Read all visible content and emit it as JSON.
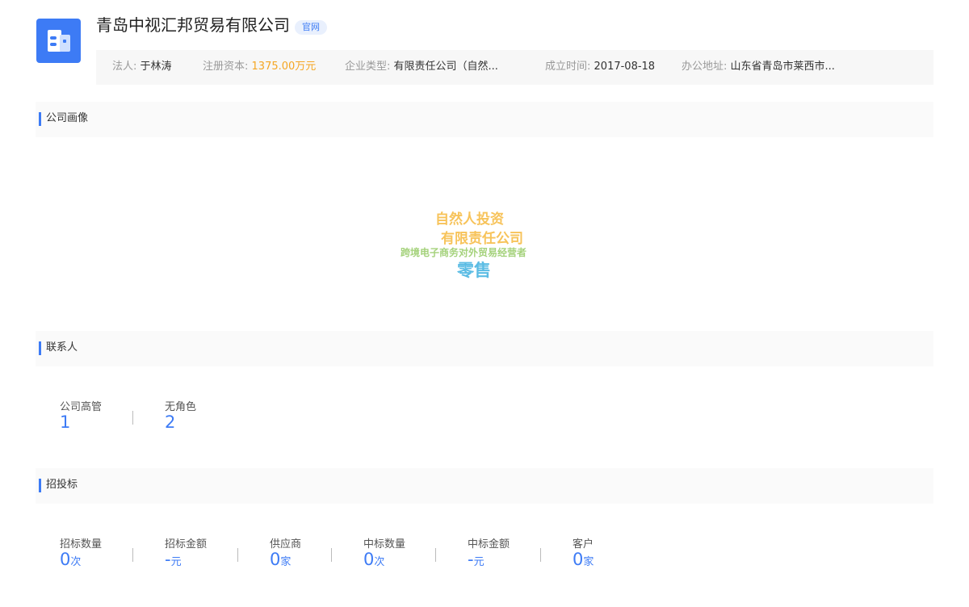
{
  "company": {
    "name": "青岛中视汇邦贸易有限公司",
    "site_tag": "官网",
    "logo_icon": "building-icon"
  },
  "info": [
    {
      "label": "法人:",
      "value": "于林涛"
    },
    {
      "label": "注册资本:",
      "value": "1375.00万元"
    },
    {
      "label": "企业类型:",
      "value": "有限责任公司（自然..."
    },
    {
      "label": "成立时间:",
      "value": "2017-08-18"
    },
    {
      "label": "办公地址:",
      "value": "山东省青岛市莱西市..."
    }
  ],
  "sections": {
    "portrait": "公司画像",
    "contacts": "联系人",
    "bidding": "招投标"
  },
  "word_cloud": {
    "words": [
      "自然人投资",
      "有限责任公司",
      "跨境电子商务对外贸易经营者",
      "零售"
    ],
    "colors": [
      "#f7c35a",
      "#f7c35a",
      "#a5d27c",
      "#5bbce4"
    ]
  },
  "contacts": [
    {
      "label": "公司高管",
      "value": "1"
    },
    {
      "label": "无角色",
      "value": "2"
    }
  ],
  "bidding": [
    {
      "label": "招标数量",
      "value": "0",
      "unit": "次"
    },
    {
      "label": "招标金额",
      "value": "-",
      "unit": "元"
    },
    {
      "label": "供应商",
      "value": "0",
      "unit": "家"
    },
    {
      "label": "中标数量",
      "value": "0",
      "unit": "次"
    },
    {
      "label": "中标金额",
      "value": "-",
      "unit": "元"
    },
    {
      "label": "客户",
      "value": "0",
      "unit": "家"
    }
  ],
  "colors": {
    "accent": "#3d7bf5",
    "orange": "#f5a623"
  }
}
